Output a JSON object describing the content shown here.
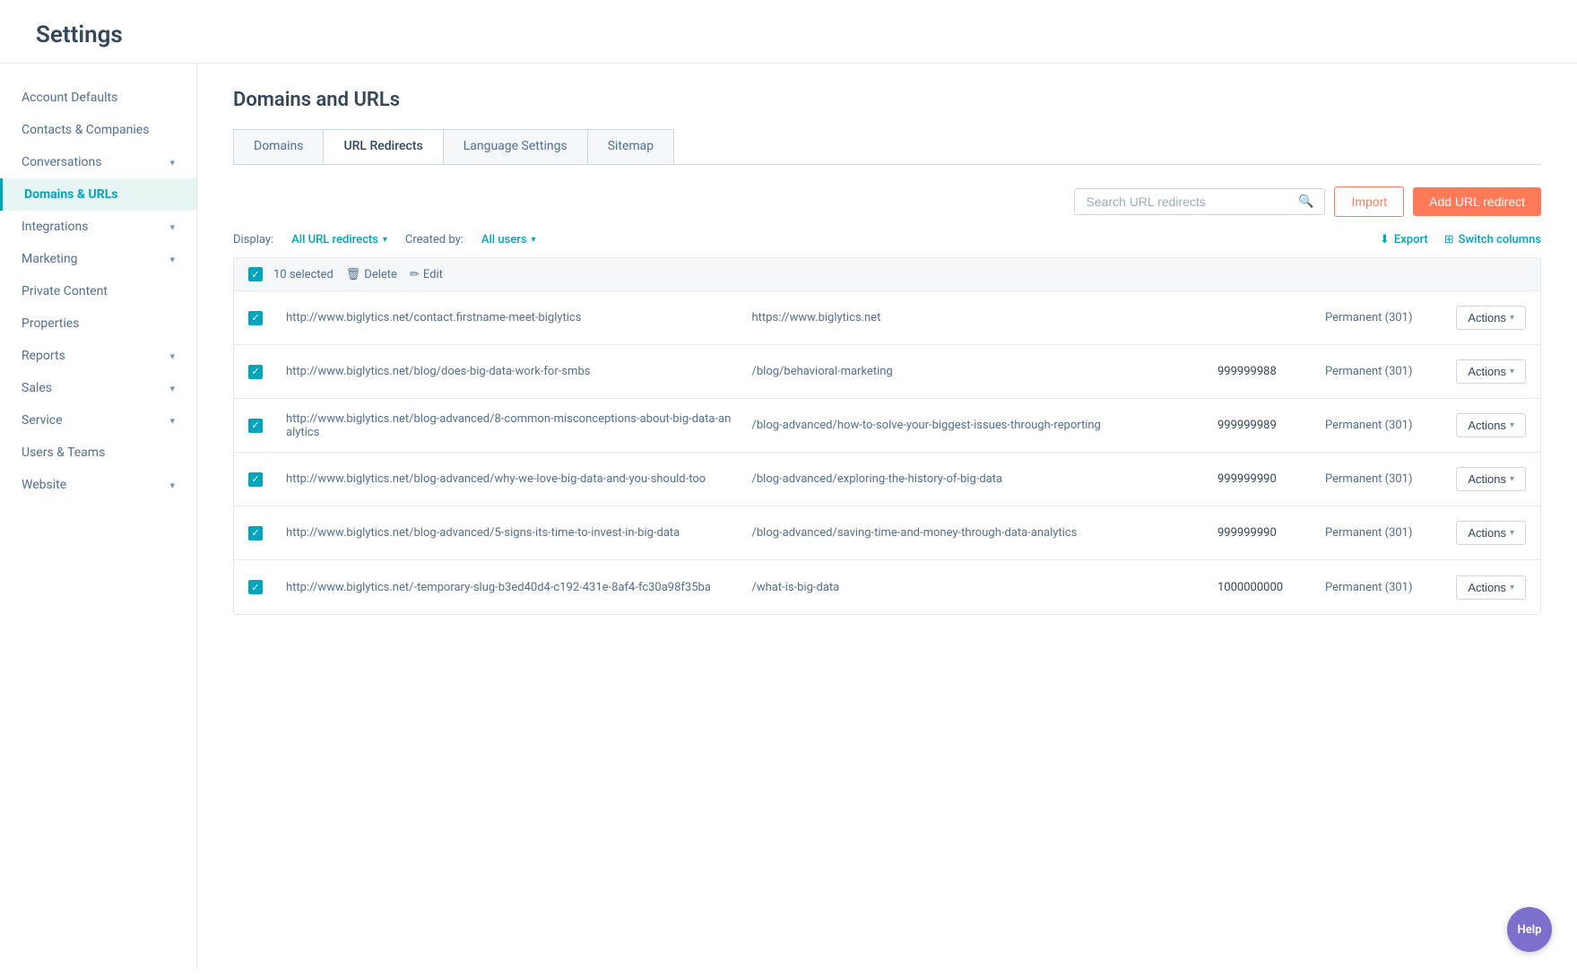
{
  "header": {
    "title": "Settings"
  },
  "sidebar": {
    "items": [
      {
        "id": "account-defaults",
        "label": "Account Defaults",
        "hasChevron": false,
        "active": false
      },
      {
        "id": "contacts-companies",
        "label": "Contacts & Companies",
        "hasChevron": false,
        "active": false
      },
      {
        "id": "conversations",
        "label": "Conversations",
        "hasChevron": true,
        "active": false
      },
      {
        "id": "domains-urls",
        "label": "Domains & URLs",
        "hasChevron": false,
        "active": true
      },
      {
        "id": "integrations",
        "label": "Integrations",
        "hasChevron": true,
        "active": false
      },
      {
        "id": "marketing",
        "label": "Marketing",
        "hasChevron": true,
        "active": false
      },
      {
        "id": "private-content",
        "label": "Private Content",
        "hasChevron": false,
        "active": false
      },
      {
        "id": "properties",
        "label": "Properties",
        "hasChevron": false,
        "active": false
      },
      {
        "id": "reports",
        "label": "Reports",
        "hasChevron": true,
        "active": false
      },
      {
        "id": "sales",
        "label": "Sales",
        "hasChevron": true,
        "active": false
      },
      {
        "id": "service",
        "label": "Service",
        "hasChevron": true,
        "active": false
      },
      {
        "id": "users-teams",
        "label": "Users & Teams",
        "hasChevron": false,
        "active": false
      },
      {
        "id": "website",
        "label": "Website",
        "hasChevron": true,
        "active": false
      }
    ]
  },
  "main": {
    "page_title": "Domains and URLs",
    "tabs": [
      {
        "id": "domains",
        "label": "Domains",
        "active": false
      },
      {
        "id": "url-redirects",
        "label": "URL Redirects",
        "active": true
      },
      {
        "id": "language-settings",
        "label": "Language Settings",
        "active": false
      },
      {
        "id": "sitemap",
        "label": "Sitemap",
        "active": false
      }
    ],
    "search_placeholder": "Search URL redirects",
    "import_label": "Import",
    "add_redirect_label": "Add URL redirect",
    "display_label": "Display:",
    "display_filter": "All URL redirects",
    "created_by_label": "Created by:",
    "created_by_filter": "All users",
    "export_label": "Export",
    "switch_columns_label": "Switch columns",
    "bulk": {
      "selected_text": "10 selected",
      "delete_label": "Delete",
      "edit_label": "Edit"
    },
    "rows": [
      {
        "checked": true,
        "original": "http://www.biglytics.net/contact.firstname-meet-biglytics",
        "destination": "https://www.biglytics.net",
        "count": "",
        "type": "Permanent (301)",
        "actions_label": "Actions"
      },
      {
        "checked": true,
        "original": "http://www.biglytics.net/blog/does-big-data-work-for-smbs",
        "destination": "/blog/behavioral-marketing",
        "count": "999999988",
        "type": "Permanent (301)",
        "actions_label": "Actions"
      },
      {
        "checked": true,
        "original": "http://www.biglytics.net/blog-advanced/8-common-misconceptions-about-big-data-analytics",
        "destination": "/blog-advanced/how-to-solve-your-biggest-issues-through-reporting",
        "count": "999999989",
        "type": "Permanent (301)",
        "actions_label": "Actions"
      },
      {
        "checked": true,
        "original": "http://www.biglytics.net/blog-advanced/why-we-love-big-data-and-you-should-too",
        "destination": "/blog-advanced/exploring-the-history-of-big-data",
        "count": "999999990",
        "type": "Permanent (301)",
        "actions_label": "Actions"
      },
      {
        "checked": true,
        "original": "http://www.biglytics.net/blog-advanced/5-signs-its-time-to-invest-in-big-data",
        "destination": "/blog-advanced/saving-time-and-money-through-data-analytics",
        "count": "999999990",
        "type": "Permanent (301)",
        "actions_label": "Actions"
      },
      {
        "checked": true,
        "original": "http://www.biglytics.net/-temporary-slug-b3ed40d4-c192-431e-8af4-fc30a98f35ba",
        "destination": "/what-is-big-data",
        "count": "1000000000",
        "type": "Permanent (301)",
        "actions_label": "Actions"
      }
    ]
  },
  "help_label": "Help",
  "icons": {
    "search": "🔍",
    "chevron_down": "▾",
    "export": "⬇",
    "switch_columns": "⊞",
    "delete": "🗑",
    "edit": "✏",
    "actions_arrow": "▾"
  }
}
